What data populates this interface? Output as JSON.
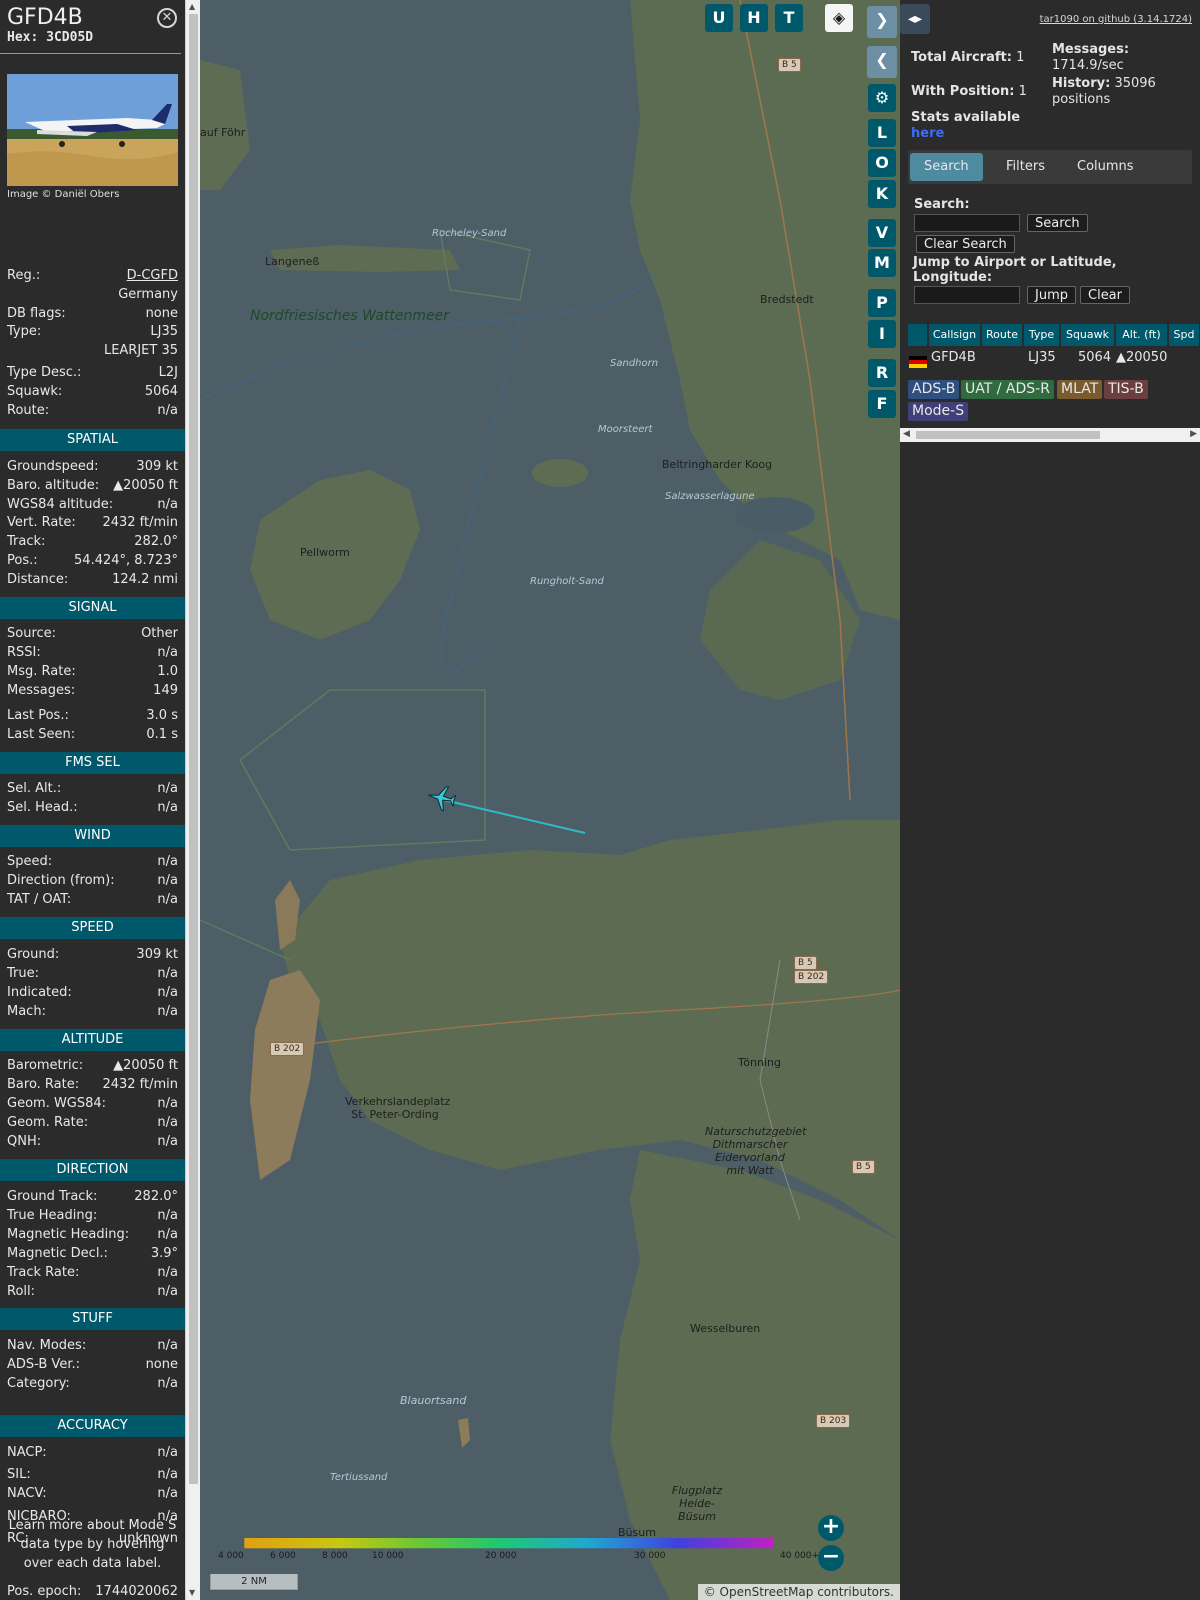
{
  "aircraft": {
    "callsign": "GFD4B",
    "hex": "Hex: 3CD05D",
    "image_credit": "Image © Daniël Obers"
  },
  "basic": [
    {
      "label": "Reg.:",
      "value": "D-CGFD"
    },
    {
      "label": "",
      "value": "Germany"
    },
    {
      "label": "DB flags:",
      "value": "none"
    },
    {
      "label": "Type:",
      "value": "LJ35"
    },
    {
      "label": "",
      "value": "LEARJET 35"
    },
    {
      "label": "Type Desc.:",
      "value": "L2J"
    },
    {
      "label": "Squawk:",
      "value": "5064"
    },
    {
      "label": "Route:",
      "value": "n/a"
    }
  ],
  "sections": [
    {
      "title": "SPATIAL",
      "rows": [
        {
          "label": "Groundspeed:",
          "value": "309 kt"
        },
        {
          "label": "Baro. altitude:",
          "value": "▲20050 ft"
        },
        {
          "label": "WGS84 altitude:",
          "value": "n/a"
        },
        {
          "label": "Vert. Rate:",
          "value": "2432 ft/min"
        },
        {
          "label": "Track:",
          "value": "282.0°"
        },
        {
          "label": "Pos.:",
          "value": "54.424°, 8.723°"
        },
        {
          "label": "Distance:",
          "value": "124.2 nmi"
        }
      ]
    },
    {
      "title": "SIGNAL",
      "rows": [
        {
          "label": "Source:",
          "value": "Other"
        },
        {
          "label": "RSSI:",
          "value": "n/a"
        },
        {
          "label": "Msg. Rate:",
          "value": "1.0"
        },
        {
          "label": "Messages:",
          "value": "149"
        },
        {
          "label": "Last Pos.:",
          "value": "3.0 s"
        },
        {
          "label": "Last Seen:",
          "value": "0.1 s"
        }
      ]
    },
    {
      "title": "FMS SEL",
      "rows": [
        {
          "label": "Sel. Alt.:",
          "value": "n/a"
        },
        {
          "label": "Sel. Head.:",
          "value": "n/a"
        }
      ]
    },
    {
      "title": "WIND",
      "rows": [
        {
          "label": "Speed:",
          "value": "n/a"
        },
        {
          "label": "Direction (from):",
          "value": "n/a"
        },
        {
          "label": "TAT / OAT:",
          "value": "n/a"
        }
      ]
    },
    {
      "title": "SPEED",
      "rows": [
        {
          "label": "Ground:",
          "value": "309 kt"
        },
        {
          "label": "True:",
          "value": "n/a"
        },
        {
          "label": "Indicated:",
          "value": "n/a"
        },
        {
          "label": "Mach:",
          "value": "n/a"
        }
      ]
    },
    {
      "title": "ALTITUDE",
      "rows": [
        {
          "label": "Barometric:",
          "value": "▲20050 ft"
        },
        {
          "label": "Baro. Rate:",
          "value": "2432 ft/min"
        },
        {
          "label": "Geom. WGS84:",
          "value": "n/a"
        },
        {
          "label": "Geom. Rate:",
          "value": "n/a"
        },
        {
          "label": "QNH:",
          "value": "n/a"
        }
      ]
    },
    {
      "title": "DIRECTION",
      "rows": [
        {
          "label": "Ground Track:",
          "value": "282.0°"
        },
        {
          "label": "True Heading:",
          "value": "n/a"
        },
        {
          "label": "Magnetic Heading:",
          "value": "n/a"
        },
        {
          "label": "Magnetic Decl.:",
          "value": "3.9°"
        },
        {
          "label": "Track Rate:",
          "value": "n/a"
        },
        {
          "label": "Roll:",
          "value": "n/a"
        }
      ]
    },
    {
      "title": "STUFF",
      "rows": [
        {
          "label": "Nav. Modes:",
          "value": "n/a"
        },
        {
          "label": "ADS-B Ver.:",
          "value": "none"
        },
        {
          "label": "Category:",
          "value": "n/a"
        }
      ]
    },
    {
      "title": "ACCURACY",
      "rows": [
        {
          "label": "NACP:",
          "value": "n/a"
        },
        {
          "label": "SIL:",
          "value": "n/a"
        },
        {
          "label": "NACV:",
          "value": "n/a"
        },
        {
          "label": "NICBARO:",
          "value": "n/a"
        },
        {
          "label": "RC:",
          "value": "unknown"
        }
      ]
    }
  ],
  "learn_more": "Learn more about Mode S data type by hovering over each data label.",
  "pos_epoch": {
    "label": "Pos. epoch:",
    "value": "1744020062"
  },
  "map": {
    "top_buttons": [
      "U",
      "H",
      "T"
    ],
    "side_buttons": [
      "L",
      "O",
      "K",
      "V",
      "M",
      "P",
      "I",
      "R",
      "F"
    ],
    "labels": {
      "wattenmeer": "Nordfriesisches Wattenmeer",
      "pellworm": "Pellworm",
      "langeness": "Langeneß",
      "rocheley": "Rocheley-Sand",
      "sandhorn": "Sandhorn",
      "moorsteert": "Moorsteert",
      "beltringharder": "Beltringharder Koog",
      "salzwasser": "Salzwasserlagune",
      "rungholt": "Rungholt-Sand",
      "bredstedt": "Bredstedt",
      "tonning": "Tönning",
      "st_peter": "Verkehrslandeplatz St. Peter-Ording",
      "naturschutz": "Naturschutzgebiet Dithmarscher Eidervorland mit Watt",
      "wesselburen": "Wesselburen",
      "blauortsand": "Blauortsand",
      "tertiussand": "Tertiussand",
      "flugplatz": "Flugplatz Heide-Büsum",
      "busum": "Büsum",
      "auf_fohr": "auf Föhr"
    },
    "road_shields": [
      "B 5",
      "B 5",
      "B 202",
      "B 202",
      "B 5",
      "B 203"
    ],
    "altitude_scale": [
      "4 000",
      "6 000",
      "8 000",
      "10 000",
      "20 000",
      "30 000",
      "40 000+"
    ],
    "distance_scale": "2 NM",
    "attribution": "© OpenStreetMap contributors."
  },
  "right": {
    "github": "tar1090 on github (3.14.1724)",
    "total_aircraft_label": "Total Aircraft:",
    "total_aircraft": "1",
    "messages_label": "Messages:",
    "messages": "1714.9/sec",
    "with_position_label": "With Position:",
    "with_position": "1",
    "history_label": "History:",
    "history": "35096 positions",
    "stats_label": "Stats available",
    "stats_link": "here",
    "tabs": [
      "Search",
      "Filters",
      "Columns"
    ],
    "search_label": "Search:",
    "search_button": "Search",
    "clear_search_button": "Clear Search",
    "jump_label": "Jump to Airport or Latitude, Longitude:",
    "jump_button": "Jump",
    "clear_button": "Clear",
    "table_headers": [
      "Callsign",
      "Route",
      "Type",
      "Squawk",
      "Alt. (ft)",
      "Spd"
    ],
    "table_row": {
      "callsign": "GFD4B",
      "route": "",
      "type": "LJ35",
      "squawk": "5064",
      "alt": "▲20050"
    },
    "sources": [
      {
        "label": "ADS-B",
        "color": "#2f4f7f"
      },
      {
        "label": "UAT / ADS-R",
        "color": "#2f6b3f"
      },
      {
        "label": "MLAT",
        "color": "#7a5a2f"
      },
      {
        "label": "TIS-B",
        "color": "#6b3f3f"
      },
      {
        "label": "Mode-S",
        "color": "#3f3f7a"
      }
    ]
  }
}
